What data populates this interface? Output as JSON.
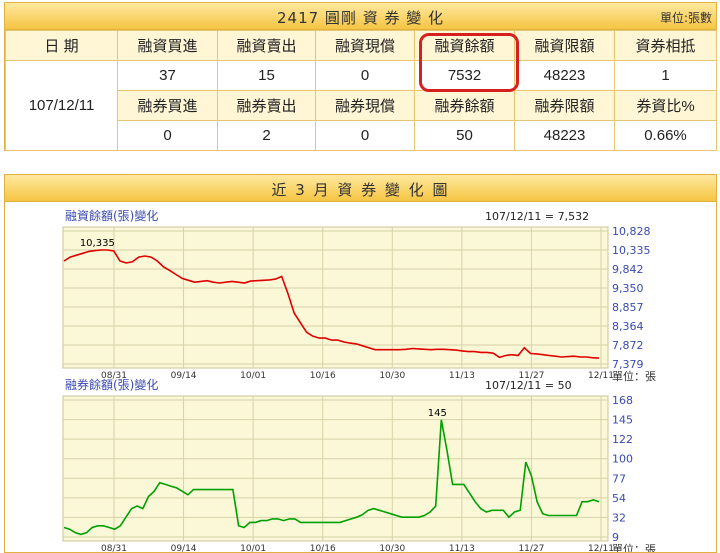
{
  "header": {
    "title": "2417 圓剛 資 券 變 化",
    "unit": "單位:張數"
  },
  "table": {
    "date_header": "日 期",
    "date": "107/12/11",
    "margin_headers": [
      "融資買進",
      "融資賣出",
      "融資現償",
      "融資餘額",
      "融資限額",
      "資券相抵"
    ],
    "margin_values": [
      "37",
      "15",
      "0",
      "7532",
      "48223",
      "1"
    ],
    "short_headers": [
      "融券買進",
      "融券賣出",
      "融券現償",
      "融券餘額",
      "融券限額",
      "券資比%"
    ],
    "short_values": [
      "0",
      "2",
      "0",
      "50",
      "48223",
      "0.66%"
    ]
  },
  "chart_section": {
    "title": "近 3 月 資 券 變 化 圖"
  },
  "chart_data": [
    {
      "type": "line",
      "title": "融資餘額(張)變化",
      "latest_label": "107/12/11 = 7,532",
      "peak_label": "10,335",
      "unit_label": "單位：張",
      "color": "#e00000",
      "ylim": [
        7379,
        10828
      ],
      "y_ticks": [
        "10,828",
        "10,335",
        "9,842",
        "9,350",
        "8,857",
        "8,364",
        "7,872",
        "7,379"
      ],
      "x_ticks": [
        "08/31",
        "09/14",
        "10/01",
        "10/16",
        "10/30",
        "11/13",
        "11/27",
        "12/11"
      ],
      "values": [
        10050,
        10150,
        10200,
        10250,
        10300,
        10320,
        10335,
        10335,
        10310,
        10050,
        10000,
        10030,
        10150,
        10180,
        10150,
        10050,
        9900,
        9800,
        9700,
        9600,
        9550,
        9500,
        9520,
        9540,
        9500,
        9480,
        9500,
        9520,
        9500,
        9480,
        9530,
        9540,
        9550,
        9560,
        9580,
        9650,
        9200,
        8700,
        8450,
        8200,
        8100,
        8050,
        8050,
        8000,
        8000,
        7950,
        7920,
        7900,
        7850,
        7800,
        7750,
        7750,
        7750,
        7750,
        7750,
        7760,
        7780,
        7770,
        7760,
        7750,
        7760,
        7760,
        7750,
        7740,
        7720,
        7700,
        7700,
        7680,
        7680,
        7660,
        7550,
        7600,
        7620,
        7600,
        7800,
        7650,
        7640,
        7620,
        7600,
        7580,
        7560,
        7570,
        7580,
        7560,
        7560,
        7540,
        7532
      ]
    },
    {
      "type": "line",
      "title": "融券餘額(張)變化",
      "latest_label": "107/12/11 = 50",
      "peak_label": "145",
      "unit_label": "單位：張",
      "color": "#00a000",
      "ylim": [
        9,
        168
      ],
      "y_ticks": [
        "168",
        "145",
        "122",
        "100",
        "77",
        "54",
        "32",
        "9"
      ],
      "x_ticks": [
        "08/31",
        "09/14",
        "10/01",
        "10/16",
        "10/30",
        "11/13",
        "11/27",
        "12/11"
      ],
      "values": [
        20,
        18,
        14,
        12,
        14,
        20,
        22,
        22,
        20,
        18,
        22,
        32,
        42,
        45,
        42,
        56,
        62,
        72,
        70,
        68,
        66,
        62,
        58,
        64,
        64,
        64,
        64,
        64,
        64,
        64,
        64,
        22,
        20,
        26,
        26,
        28,
        28,
        30,
        30,
        28,
        30,
        30,
        26,
        26,
        26,
        26,
        26,
        26,
        26,
        26,
        28,
        30,
        32,
        35,
        40,
        42,
        40,
        38,
        36,
        34,
        32,
        32,
        32,
        32,
        34,
        38,
        45,
        145,
        110,
        70,
        70,
        70,
        60,
        50,
        42,
        38,
        40,
        40,
        40,
        32,
        38,
        40,
        96,
        80,
        50,
        36,
        34,
        34,
        34,
        34,
        34,
        34,
        50,
        50,
        52,
        50
      ]
    }
  ]
}
